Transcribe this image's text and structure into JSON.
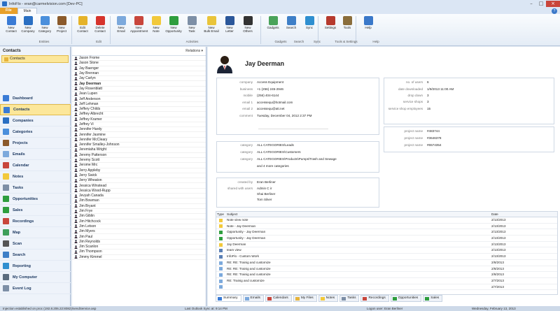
{
  "window": {
    "title": "InfoFlo - eran@carmelvision.com [Dev-PC]"
  },
  "ribbon_tabs": [
    "File",
    "Main"
  ],
  "ribbon": {
    "buttons": [
      {
        "id": "new-contact",
        "label": "New\nContact",
        "color": "#3a7bd5"
      },
      {
        "id": "new-company",
        "label": "New\nCompany",
        "color": "#2a6fc2"
      },
      {
        "id": "new-category",
        "label": "New\nCategory",
        "color": "#4a8fdc"
      },
      {
        "id": "new-project",
        "label": "New\nProject",
        "color": "#8b5a2b"
      },
      {
        "id": "edit-contact",
        "label": "Edit\nContact",
        "color": "#e5b32a"
      },
      {
        "id": "delete-contact",
        "label": "Delete\nContact",
        "color": "#d6342c"
      },
      {
        "id": "new-email",
        "label": "New\nEmail",
        "color": "#7ca9dc"
      },
      {
        "id": "new-appointment",
        "label": "New\nAppointment",
        "color": "#c8463c"
      },
      {
        "id": "new-note",
        "label": "New\nNote",
        "color": "#f2c93b"
      },
      {
        "id": "new-opportunity",
        "label": "New\nOpportunity",
        "color": "#2e9e3e"
      },
      {
        "id": "new-task",
        "label": "New\nTask",
        "color": "#7d8fa6"
      },
      {
        "id": "new-bulk-email",
        "label": "New\nBulk Email",
        "color": "#e9c43a"
      },
      {
        "id": "new-letter",
        "label": "New\nLetter",
        "color": "#2b579a"
      },
      {
        "id": "new-others",
        "label": "New\nOthers",
        "color": "#333333"
      },
      {
        "id": "gadgets",
        "label": "Gadgets",
        "color": "#4aa35a"
      },
      {
        "id": "search",
        "label": "Search",
        "color": "#3e7fc7"
      },
      {
        "id": "sync",
        "label": "Sync",
        "color": "#2f8fd0"
      },
      {
        "id": "settings",
        "label": "Settings",
        "color": "#b63a2e"
      },
      {
        "id": "tools",
        "label": "Tools",
        "color": "#8a6d3b"
      },
      {
        "id": "help",
        "label": "Help",
        "color": "#3a78c9"
      }
    ],
    "groups": [
      "Entities",
      "Edit",
      "Activities",
      "Gadgets",
      "Search",
      "Sync",
      "Tools & Settings",
      "Help"
    ]
  },
  "leftnav": {
    "header": "Contacts",
    "selected_folder": "Contacts",
    "items": [
      {
        "label": "Dashboard",
        "color": "#3a7bd5"
      },
      {
        "label": "Contacts",
        "color": "#3a7bd5"
      },
      {
        "label": "Companies",
        "color": "#2a6fc2"
      },
      {
        "label": "Categories",
        "color": "#4a8fdc"
      },
      {
        "label": "Projects",
        "color": "#8b5a2b"
      },
      {
        "label": "Emails",
        "color": "#7ca9dc"
      },
      {
        "label": "Calendar",
        "color": "#c8463c"
      },
      {
        "label": "Notes",
        "color": "#f2c93b"
      },
      {
        "label": "Tasks",
        "color": "#7d8fa6"
      },
      {
        "label": "Opportunities",
        "color": "#2e9e3e"
      },
      {
        "label": "Sales",
        "color": "#2e9e3e"
      },
      {
        "label": "Recordings",
        "color": "#c8463c"
      },
      {
        "label": "Map",
        "color": "#3e9f5a"
      },
      {
        "label": "Scan",
        "color": "#555555"
      },
      {
        "label": "Search",
        "color": "#3e7fc7"
      },
      {
        "label": "Reporting",
        "color": "#2f8fd0"
      },
      {
        "label": "My Computer",
        "color": "#5a6b7d"
      },
      {
        "label": "Event Log",
        "color": "#7d8fa6"
      }
    ]
  },
  "contact_list": {
    "header": "Relations ▾",
    "contacts": [
      "Jason Frome",
      "Jason Stone",
      "Jay Baenger",
      "Jay Brennan",
      "Jay Carlyn",
      "Jay Deerman",
      "Jay Rosenblatt",
      "Jean Lupen",
      "Jeff Anderson",
      "Jeff Lehman",
      "Jeffery Childs",
      "Jeffrey Albrecht",
      "Jeffrey Kramer",
      "Jeffrey Vi",
      "Jennifer Hardy",
      "Jennifer Jasmine",
      "Jennifer McCleary",
      "Jennifer Smalley-Johnson",
      "Jeremiaha Wright",
      "Jeremy Patterson",
      "Jeremy Scott",
      "Jerome Mrc",
      "Jerry Appleby",
      "Jerry Swick",
      "Jerry Wheaton",
      "Jessica Winstead",
      "Jessica Wood-Rupp",
      "Jevyah Canada",
      "Jim Bowman",
      "Jim Bryant",
      "Jim Frye",
      "Jim Giblin",
      "Jim Hitchcock",
      "Jim Letson",
      "Jim Myers",
      "Jim Paul",
      "Jim Reynolds",
      "Jim Scanlon",
      "Jim Thompson",
      "Jimmy Kimmel"
    ],
    "selected": "Jay Deerman"
  },
  "detail": {
    "name": "Jay Deerman",
    "fields": [
      {
        "label": "company",
        "value": "Access Equipment"
      },
      {
        "label": "business",
        "value": "+1 (256) 245-2946"
      },
      {
        "label": "mobile",
        "value": "(256) 404-6144"
      },
      {
        "label": "email 1",
        "value": "accessequ@hotmail.com"
      },
      {
        "label": "email 2",
        "value": "accessequ@att.net"
      },
      {
        "label": "comment",
        "value": "Tuesday, December 04, 2012 2:37 PM"
      }
    ],
    "stats": [
      {
        "label": "no. of users",
        "value": "6"
      },
      {
        "label": "date downloaded",
        "value": "1/9/2013 11:00 AM"
      },
      {
        "label": "drop down",
        "value": "3"
      },
      {
        "label": "service shops",
        "value": "3"
      },
      {
        "label": "service shop employees",
        "value": "15"
      }
    ],
    "projects": [
      {
        "label": "project name",
        "value": "#483744"
      },
      {
        "label": "project name",
        "value": "#3646378"
      },
      {
        "label": "project name",
        "value": "#6574354"
      }
    ],
    "categories": [
      {
        "label": "category",
        "value": "ALL CATEGORIES\\Leads"
      },
      {
        "label": "category",
        "value": "ALL CATEGORIES\\Customers"
      },
      {
        "label": "category",
        "value": "ALL CATEGORIES\\Products\\Pumps\\Trash and Sewage"
      },
      {
        "label": "",
        "value": "and 4 more categories"
      }
    ],
    "created_by": {
      "label": "created by",
      "value": "Eran Berliner"
    },
    "shared": {
      "label": "shared with users",
      "values": [
        "Admin C ir",
        "Shai Berliner",
        "Tom Silver"
      ]
    }
  },
  "activity_table": {
    "headers": {
      "type": "Type",
      "subject": "Subject",
      "date": "Date"
    },
    "rows": [
      {
        "type": "note",
        "subject": "Note view note",
        "date": "2/13/2013"
      },
      {
        "type": "note",
        "subject": "Note - Jay Deerman",
        "date": "2/13/2013"
      },
      {
        "type": "opportunity",
        "subject": "Opportunity - Jay Deerman",
        "date": "2/13/2013"
      },
      {
        "type": "opportunity",
        "subject": "Opportunity - Jay Deerman",
        "date": "2/13/2013"
      },
      {
        "type": "note",
        "subject": "Jay Deerman",
        "date": "2/13/2013"
      },
      {
        "type": "doc",
        "subject": "team view",
        "date": "2/13/2013"
      },
      {
        "type": "doc",
        "subject": "InfoFlo - Custom Work",
        "date": "2/13/2013"
      },
      {
        "type": "email",
        "subject": "RE: RE: Trainig and customize",
        "date": "2/8/2013"
      },
      {
        "type": "email",
        "subject": "RE: RE: Trainig and customize",
        "date": "2/8/2013"
      },
      {
        "type": "email",
        "subject": "RE: RE: Trainig and customize",
        "date": "2/8/2013"
      },
      {
        "type": "email",
        "subject": "RE: Trainig and customize",
        "date": "2/7/2013"
      },
      {
        "type": "email",
        "subject": "",
        "date": "2/7/2013"
      }
    ]
  },
  "bottom_tabs": [
    {
      "label": "Summary",
      "color": "#3a7bd5"
    },
    {
      "label": "Emails",
      "color": "#7ca9dc"
    },
    {
      "label": "Calendars",
      "color": "#c8463c"
    },
    {
      "label": "My Files",
      "color": "#e6b43c"
    },
    {
      "label": "Notes",
      "color": "#f2c93b"
    },
    {
      "label": "Tasks",
      "color": "#7d8fa6"
    },
    {
      "label": "Recordings",
      "color": "#c8463c"
    },
    {
      "label": "Opportunities",
      "color": "#2e9e3e"
    },
    {
      "label": "Sales",
      "color": "#2e9e3e"
    }
  ],
  "statusbar": {
    "left": "Injection established on proc (192.8.206.22:8082)/sendService.asp",
    "mid": "Last Outlook Sync at: 9:14 PM",
    "right": "Logon user: Eran Berliner",
    "date": "Wednesday, February 13, 2013"
  }
}
